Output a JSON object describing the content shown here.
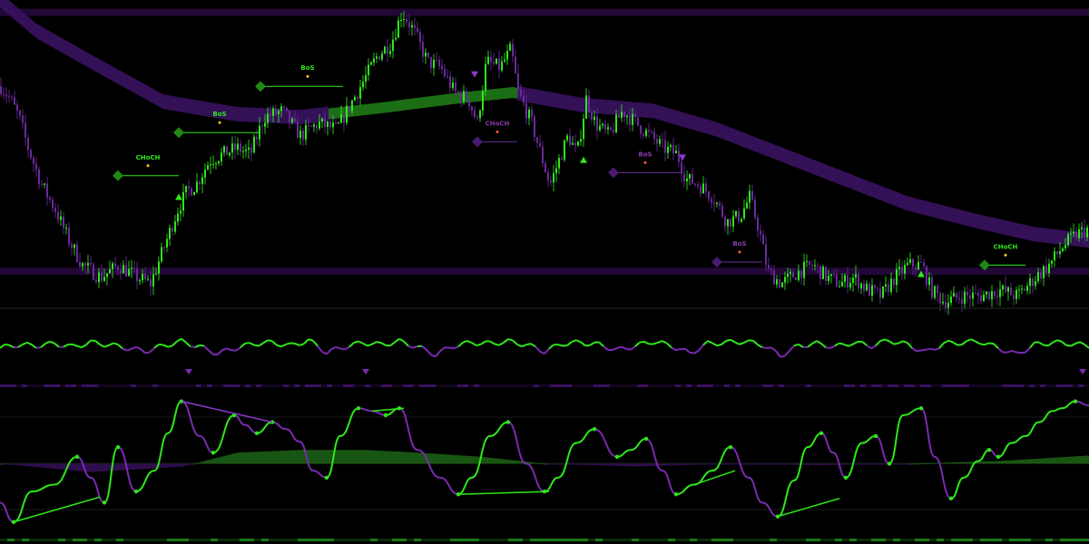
{
  "colors": {
    "background": "#000000",
    "bull": "#2ee81a",
    "bear": "#6a2a9a",
    "cloud_bull": "#1f7a16",
    "cloud_bear": "#3a1260",
    "level": "#2a0a44",
    "dot_bull": "#f5d000",
    "dot_bear": "#ff5a3c"
  },
  "chart_data": [
    {
      "type": "candlestick",
      "panel": "price",
      "title": "",
      "xlabel": "",
      "ylabel": "",
      "x_range": [
        0,
        1200
      ],
      "ylim": [
        0,
        100
      ],
      "path": [
        [
          0,
          72
        ],
        [
          10,
          68
        ],
        [
          20,
          62
        ],
        [
          30,
          52
        ],
        [
          45,
          40
        ],
        [
          60,
          32
        ],
        [
          75,
          22
        ],
        [
          90,
          14
        ],
        [
          110,
          10
        ],
        [
          130,
          14
        ],
        [
          150,
          10
        ],
        [
          165,
          8
        ],
        [
          180,
          20
        ],
        [
          195,
          32
        ],
        [
          205,
          38
        ],
        [
          215,
          40
        ],
        [
          230,
          48
        ],
        [
          245,
          50
        ],
        [
          260,
          52
        ],
        [
          275,
          50
        ],
        [
          290,
          62
        ],
        [
          310,
          64
        ],
        [
          330,
          56
        ],
        [
          350,
          60
        ],
        [
          370,
          58
        ],
        [
          385,
          66
        ],
        [
          400,
          74
        ],
        [
          415,
          82
        ],
        [
          430,
          86
        ],
        [
          442,
          96
        ],
        [
          455,
          90
        ],
        [
          470,
          80
        ],
        [
          485,
          78
        ],
        [
          500,
          70
        ],
        [
          515,
          68
        ],
        [
          525,
          60
        ],
        [
          535,
          80
        ],
        [
          550,
          78
        ],
        [
          562,
          84
        ],
        [
          570,
          70
        ],
        [
          585,
          60
        ],
        [
          595,
          50
        ],
        [
          605,
          40
        ],
        [
          615,
          48
        ],
        [
          625,
          56
        ],
        [
          635,
          50
        ],
        [
          645,
          68
        ],
        [
          655,
          60
        ],
        [
          670,
          56
        ],
        [
          685,
          64
        ],
        [
          700,
          60
        ],
        [
          715,
          56
        ],
        [
          730,
          52
        ],
        [
          745,
          50
        ],
        [
          755,
          42
        ],
        [
          770,
          40
        ],
        [
          785,
          36
        ],
        [
          800,
          28
        ],
        [
          815,
          30
        ],
        [
          825,
          36
        ],
        [
          835,
          26
        ],
        [
          845,
          12
        ],
        [
          860,
          8
        ],
        [
          880,
          12
        ],
        [
          895,
          14
        ],
        [
          910,
          10
        ],
        [
          925,
          8
        ],
        [
          940,
          10
        ],
        [
          955,
          6
        ],
        [
          970,
          4
        ],
        [
          985,
          10
        ],
        [
          1000,
          14
        ],
        [
          1015,
          14
        ],
        [
          1025,
          6
        ],
        [
          1040,
          2
        ],
        [
          1060,
          4
        ],
        [
          1080,
          4
        ],
        [
          1100,
          6
        ],
        [
          1120,
          4
        ],
        [
          1140,
          10
        ],
        [
          1155,
          14
        ],
        [
          1170,
          20
        ],
        [
          1185,
          24
        ],
        [
          1200,
          26
        ]
      ],
      "moving_average_band": [
        [
          0,
          100
        ],
        [
          40,
          90
        ],
        [
          100,
          80
        ],
        [
          180,
          67
        ],
        [
          260,
          63
        ],
        [
          330,
          62
        ],
        [
          420,
          65
        ],
        [
          500,
          68
        ],
        [
          565,
          70
        ],
        [
          640,
          66
        ],
        [
          720,
          64
        ],
        [
          790,
          58
        ],
        [
          860,
          50
        ],
        [
          930,
          42
        ],
        [
          1000,
          34
        ],
        [
          1080,
          28
        ],
        [
          1140,
          24
        ],
        [
          1200,
          22
        ]
      ],
      "horizontal_levels": [
        96,
        12
      ],
      "structure_labels": [
        {
          "text": "CHoCH",
          "x": 163,
          "y": 43,
          "direction": "bull",
          "line_from_x": 130,
          "line_to_x": 197
        },
        {
          "text": "BoS",
          "x": 242,
          "y": 57,
          "direction": "bull",
          "line_from_x": 197,
          "line_to_x": 286
        },
        {
          "text": "BoS",
          "x": 339,
          "y": 72,
          "direction": "bull",
          "line_from_x": 287,
          "line_to_x": 378
        },
        {
          "text": "CHoCH",
          "x": 548,
          "y": 54,
          "direction": "bear",
          "line_from_x": 526,
          "line_to_x": 570
        },
        {
          "text": "BoS",
          "x": 711,
          "y": 44,
          "direction": "bear",
          "line_from_x": 676,
          "line_to_x": 750
        },
        {
          "text": "BoS",
          "x": 815,
          "y": 15,
          "direction": "bear",
          "line_from_x": 790,
          "line_to_x": 840
        },
        {
          "text": "CHoCH",
          "x": 1108,
          "y": 14,
          "direction": "bull",
          "line_from_x": 1085,
          "line_to_x": 1130
        }
      ],
      "signals": [
        {
          "x": 197,
          "y": 36,
          "dir": "up"
        },
        {
          "x": 523,
          "y": 76,
          "dir": "down"
        },
        {
          "x": 643,
          "y": 48,
          "dir": "up"
        },
        {
          "x": 752,
          "y": 49,
          "dir": "down"
        },
        {
          "x": 1015,
          "y": 11,
          "dir": "up"
        }
      ]
    },
    {
      "type": "line",
      "panel": "momentum",
      "title": "",
      "series": [
        {
          "values": [
            0.1,
            0.4,
            0.3,
            0.5,
            0.2,
            0.6,
            0.4,
            0.1,
            -0.2,
            0.3,
            0.7,
            0.2,
            -0.4,
            0.1,
            0.5,
            0.6,
            0.3,
            0.8,
            -0.3,
            0.2,
            0.6,
            0.4,
            0.7,
            0.2,
            -0.5,
            0.3,
            0.6,
            0.5,
            0.7,
            0.4,
            -0.2,
            0.5,
            0.6,
            0.4,
            -0.1,
            0.3,
            0.7,
            0.3,
            -0.4,
            0.5,
            0.6,
            0.7,
            0.4,
            -0.6,
            0.3,
            0.5,
            0.2,
            0.6,
            0.3,
            0.8,
            0.4,
            -0.3,
            0.5,
            0.6,
            0.7,
            0.1,
            -0.5,
            0.4,
            0.6,
            0.5,
            0.3
          ]
        }
      ],
      "markers": [
        208,
        403,
        1193
      ],
      "ylim": [
        -1,
        1
      ]
    },
    {
      "type": "line",
      "panel": "oscillator",
      "title": "",
      "ylim": [
        0,
        100
      ],
      "series": [
        {
          "values": [
            [
              0,
              22
            ],
            [
              15,
              8
            ],
            [
              35,
              30
            ],
            [
              60,
              35
            ],
            [
              85,
              55
            ],
            [
              100,
              40
            ],
            [
              115,
              22
            ],
            [
              130,
              62
            ],
            [
              150,
              30
            ],
            [
              170,
              45
            ],
            [
              185,
              72
            ],
            [
              200,
              95
            ],
            [
              220,
              70
            ],
            [
              235,
              58
            ],
            [
              258,
              85
            ],
            [
              270,
              78
            ],
            [
              283,
              72
            ],
            [
              300,
              80
            ],
            [
              315,
              75
            ],
            [
              330,
              66
            ],
            [
              345,
              45
            ],
            [
              360,
              40
            ],
            [
              375,
              70
            ],
            [
              395,
              90
            ],
            [
              410,
              88
            ],
            [
              425,
              85
            ],
            [
              440,
              90
            ],
            [
              460,
              60
            ],
            [
              485,
              40
            ],
            [
              505,
              28
            ],
            [
              520,
              40
            ],
            [
              540,
              70
            ],
            [
              560,
              80
            ],
            [
              580,
              50
            ],
            [
              600,
              30
            ],
            [
              615,
              40
            ],
            [
              635,
              65
            ],
            [
              655,
              75
            ],
            [
              680,
              55
            ],
            [
              695,
              60
            ],
            [
              712,
              68
            ],
            [
              730,
              45
            ],
            [
              745,
              28
            ],
            [
              765,
              35
            ],
            [
              785,
              45
            ],
            [
              805,
              62
            ],
            [
              825,
              40
            ],
            [
              840,
              22
            ],
            [
              857,
              12
            ],
            [
              875,
              38
            ],
            [
              890,
              62
            ],
            [
              905,
              72
            ],
            [
              918,
              58
            ],
            [
              932,
              40
            ],
            [
              950,
              65
            ],
            [
              965,
              70
            ],
            [
              980,
              50
            ],
            [
              995,
              85
            ],
            [
              1015,
              90
            ],
            [
              1030,
              55
            ],
            [
              1048,
              25
            ],
            [
              1062,
              40
            ],
            [
              1078,
              52
            ],
            [
              1090,
              60
            ],
            [
              1100,
              55
            ],
            [
              1115,
              65
            ],
            [
              1130,
              70
            ],
            [
              1145,
              80
            ],
            [
              1160,
              88
            ],
            [
              1170,
              90
            ],
            [
              1185,
              95
            ],
            [
              1200,
              92
            ]
          ]
        }
      ],
      "divergence_lines": [
        [
          [
            15,
            8
          ],
          [
            110,
            26
          ]
        ],
        [
          [
            200,
            95
          ],
          [
            300,
            80
          ]
        ],
        [
          [
            505,
            28
          ],
          [
            605,
            30
          ]
        ],
        [
          [
            765,
            35
          ],
          [
            810,
            45
          ]
        ],
        [
          [
            857,
            12
          ],
          [
            925,
            25
          ]
        ],
        [
          [
            410,
            88
          ],
          [
            445,
            90
          ]
        ]
      ],
      "baseline_fill_values": [
        [
          0,
          50
        ],
        [
          100,
          44
        ],
        [
          200,
          48
        ],
        [
          260,
          58
        ],
        [
          330,
          60
        ],
        [
          400,
          60
        ],
        [
          460,
          58
        ],
        [
          530,
          55
        ],
        [
          600,
          50
        ],
        [
          700,
          48
        ],
        [
          800,
          50
        ],
        [
          900,
          49
        ],
        [
          1000,
          50
        ],
        [
          1100,
          52
        ],
        [
          1200,
          56
        ]
      ]
    }
  ]
}
